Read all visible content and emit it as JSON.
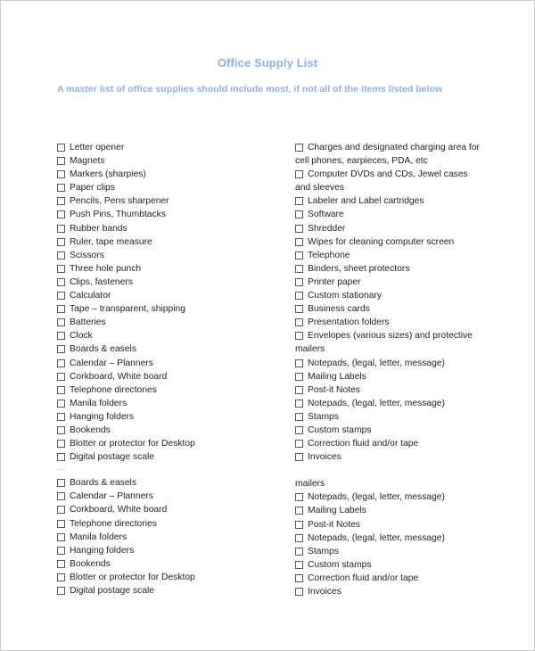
{
  "document": {
    "title": "Office Supply List",
    "subtitle": "A master list of office supplies should include most, if not all of the items listed below",
    "title_color": "#8fb0e8",
    "subtitle_color": "#8fb0e8",
    "text_color": "#231f20",
    "checkbox_border_color": "#58595b",
    "page_border_color": "#cccccc",
    "background_color": "#ffffff"
  },
  "columns": {
    "left": {
      "groups": [
        {
          "items": [
            "Letter opener",
            "Magnets",
            "Markers (sharpies)",
            "Paper clips",
            "Pencils, Pens sharpener",
            "Push Pins, Thumbtacks",
            "Rubber bands",
            "Ruler, tape measure",
            "Scissors",
            "Three hole punch",
            "Clips, fasteners",
            "Calculator",
            "Tape – transparent, shipping",
            "Batteries",
            "Clock",
            "Boards & easels",
            "Calendar – Planners",
            "Corkboard, White board",
            "Telephone directories",
            "Manila folders",
            "Hanging folders",
            "Bookends",
            "Blotter or protector for Desktop",
            "Digital postage scale"
          ]
        },
        {
          "items": [
            "Boards & easels",
            "Calendar – Planners",
            "Corkboard, White board",
            "Telephone directories",
            "Manila folders",
            "Hanging folders",
            "Bookends",
            "Blotter or protector for Desktop",
            "Digital postage scale"
          ]
        }
      ]
    },
    "right": {
      "groups": [
        {
          "items": [
            {
              "label": "Charges and designated charging area for",
              "continuation": "cell phones, earpieces, PDA, etc"
            },
            {
              "label": "Computer DVDs and CDs, Jewel cases",
              "continuation": "and sleeves"
            },
            {
              "label": "Labeler and Label cartridges"
            },
            {
              "label": "Software"
            },
            {
              "label": "Shredder"
            },
            {
              "label": "Wipes for cleaning computer screen"
            },
            {
              "label": "Telephone"
            },
            {
              "label": "Binders, sheet protectors"
            },
            {
              "label": "Printer paper"
            },
            {
              "label": "Custom stationary"
            },
            {
              "label": "Business cards"
            },
            {
              "label": "Presentation folders"
            },
            {
              "label": "Envelopes (various sizes) and protective",
              "continuation": "mailers"
            },
            {
              "label": "Notepads, (legal, letter, message)"
            },
            {
              "label": "Mailing Labels"
            },
            {
              "label": "Post-it Notes"
            },
            {
              "label": "Notepads, (legal, letter, message)"
            },
            {
              "label": "Stamps"
            },
            {
              "label": "Custom stamps"
            },
            {
              "label": "Correction fluid and/or tape"
            },
            {
              "label": "Invoices"
            }
          ]
        },
        {
          "orphan_line": "mailers",
          "items": [
            {
              "label": "Notepads, (legal, letter, message)"
            },
            {
              "label": "Mailing Labels"
            },
            {
              "label": "Post-it Notes"
            },
            {
              "label": "Notepads, (legal, letter, message)"
            },
            {
              "label": "Stamps"
            },
            {
              "label": "Custom stamps"
            },
            {
              "label": "Correction fluid and/or tape"
            },
            {
              "label": "Invoices"
            }
          ]
        }
      ]
    }
  }
}
